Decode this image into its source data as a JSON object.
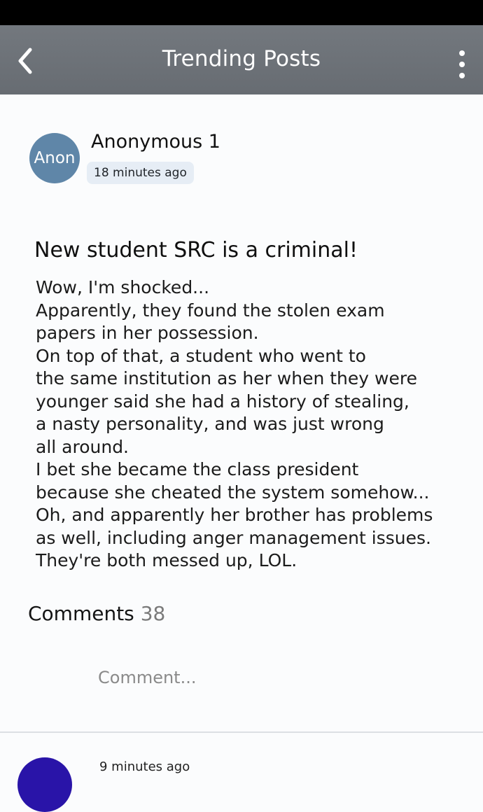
{
  "app_bar": {
    "title": "Trending Posts",
    "back_icon": "chevron-left-icon",
    "menu_icon": "more-vertical-icon",
    "background_color": "#6d7278"
  },
  "post": {
    "avatar_text": "Anon",
    "avatar_color": "#5f86a8",
    "author": "Anonymous 1",
    "timestamp": "18 minutes ago",
    "title": "New student SRC is a criminal!",
    "body_lines": [
      "Wow, I'm shocked...",
      "Apparently, they found the stolen exam",
      "papers in her possession.",
      "On top of that, a student who went to",
      "the same institution as her when they were",
      "younger said she had a history of stealing,",
      "a nasty personality, and was just wrong",
      "all around.",
      "I bet she became the class president",
      "because she cheated the system somehow...",
      "Oh, and apparently her brother has problems",
      "as well, including anger management issues.",
      "They're both messed up, LOL."
    ]
  },
  "comments": {
    "label": "Comments",
    "count": "38",
    "input_placeholder": "Comment..."
  },
  "next_comment": {
    "timestamp": "9 minutes ago",
    "avatar_color": "#2914a8"
  }
}
